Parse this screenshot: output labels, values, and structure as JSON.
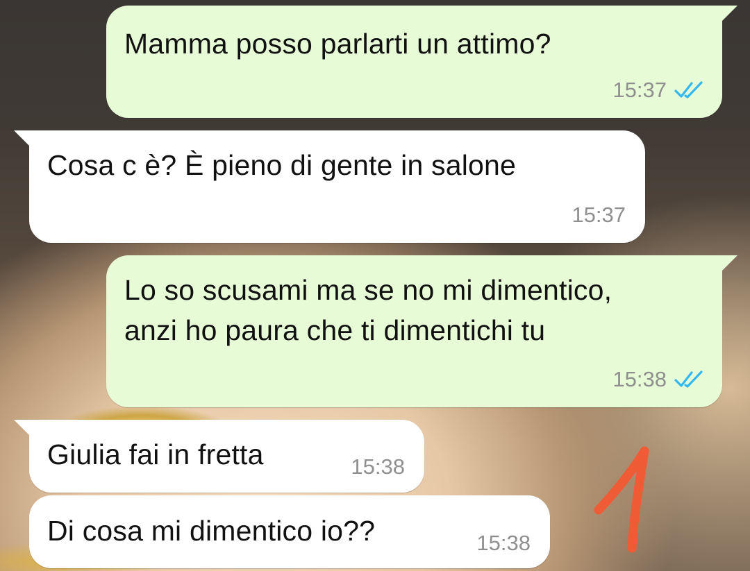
{
  "messages": [
    {
      "direction": "outgoing",
      "lines": [
        "Mamma posso parlarti un attimo?"
      ],
      "time": "15:37",
      "status_icon": "double-check-read-icon"
    },
    {
      "direction": "incoming",
      "lines": [
        "Cosa c è? È pieno di gente in salone"
      ],
      "time": "15:37"
    },
    {
      "direction": "outgoing",
      "lines": [
        "Lo so scusami ma se no mi dimentico,",
        "anzi ho paura che ti dimentichi tu"
      ],
      "time": "15:38",
      "status_icon": "double-check-read-icon"
    },
    {
      "direction": "incoming",
      "lines": [
        "Giulia fai in fretta"
      ],
      "time": "15:38"
    },
    {
      "direction": "incoming",
      "lines": [
        "Di cosa mi dimentico io??"
      ],
      "time": "15:38"
    }
  ],
  "annotation": {
    "text": "1",
    "color": "#ef5b35"
  },
  "colors": {
    "outgoing_bubble": "#e7fcd6",
    "incoming_bubble": "#ffffff",
    "read_tick": "#34b7f1",
    "timestamp": "#8f8f8f"
  }
}
